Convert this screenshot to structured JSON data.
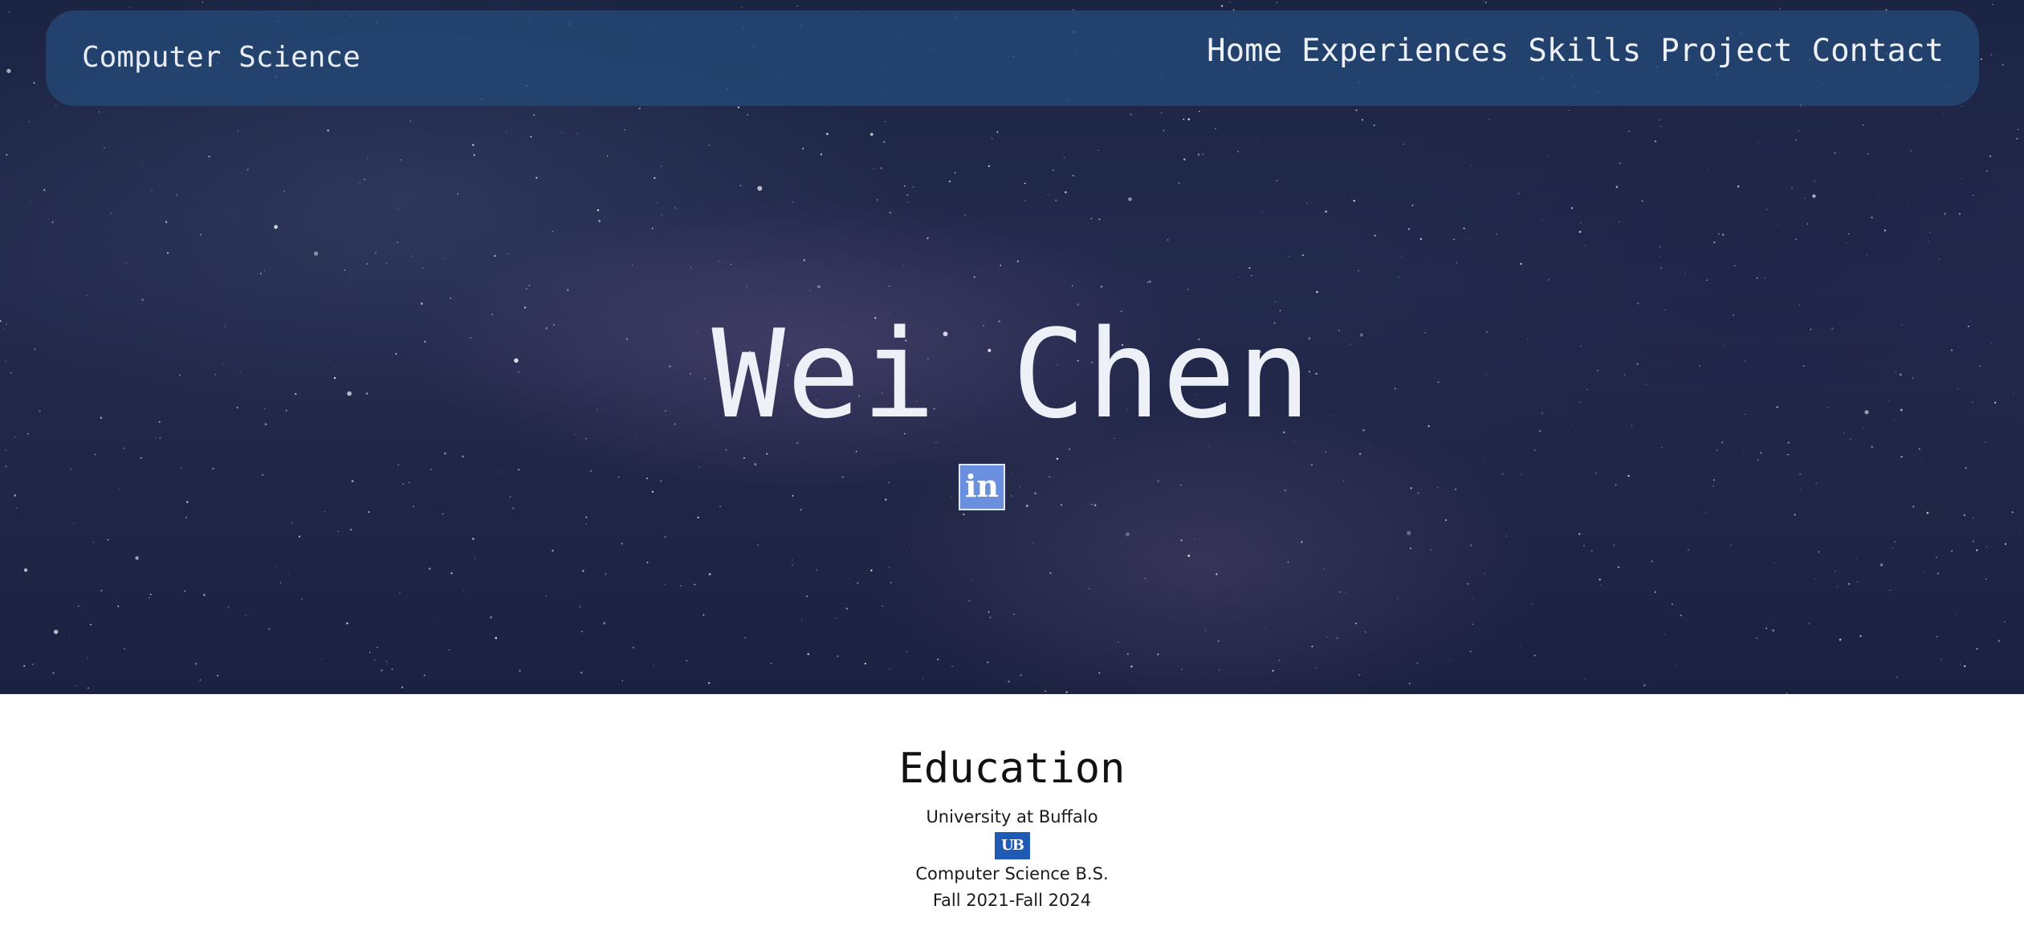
{
  "navbar": {
    "brand": "Computer Science",
    "links": [
      "Home",
      "Experiences",
      "Skills",
      "Project",
      "Contact"
    ]
  },
  "hero": {
    "name": "Wei Chen",
    "social_icon": "linkedin-icon",
    "social_label": "in"
  },
  "education": {
    "title": "Education",
    "school": "University at Buffalo",
    "logo_icon": "ub-logo",
    "logo_text": "UB",
    "degree": "Computer Science B.S.",
    "dates": "Fall 2021-Fall 2024"
  },
  "colors": {
    "navbar_bg": "#234673",
    "hero_bg": "#1f2545",
    "linkedin_blue": "#6b8fdf",
    "ub_blue": "#1f5bb4"
  }
}
